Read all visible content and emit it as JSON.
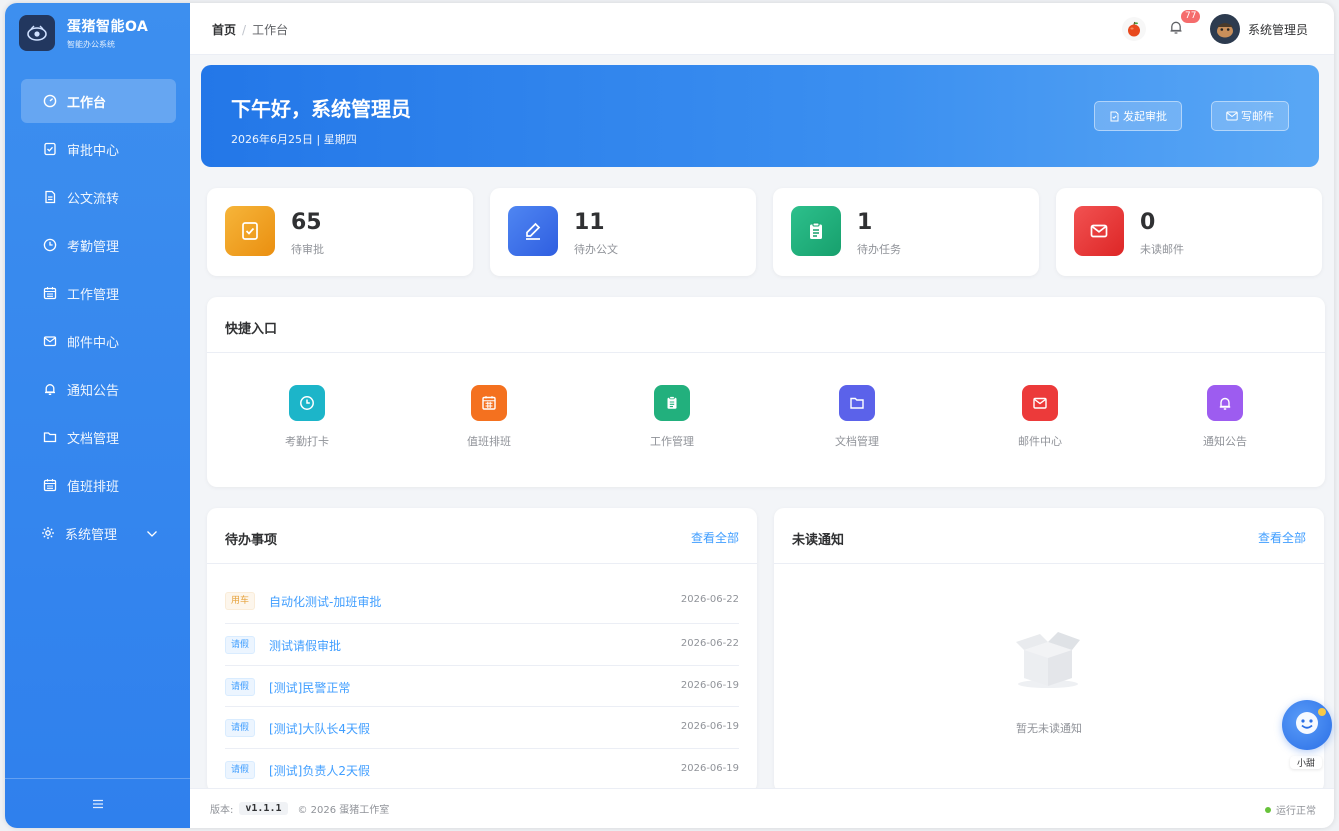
{
  "brand": {
    "title": "蛋猪智能OA",
    "subtitle": "智能办公系统"
  },
  "sidebar": {
    "items": [
      {
        "label": "工作台",
        "icon": "dashboard-icon",
        "active": true
      },
      {
        "label": "审批中心",
        "icon": "approval-icon"
      },
      {
        "label": "公文流转",
        "icon": "document-icon"
      },
      {
        "label": "考勤管理",
        "icon": "clock-icon"
      },
      {
        "label": "工作管理",
        "icon": "calendar-icon"
      },
      {
        "label": "邮件中心",
        "icon": "mail-icon"
      },
      {
        "label": "通知公告",
        "icon": "bell-icon"
      },
      {
        "label": "文档管理",
        "icon": "folder-icon"
      },
      {
        "label": "值班排班",
        "icon": "schedule-icon"
      },
      {
        "label": "系统管理",
        "icon": "gear-icon",
        "expandable": true
      }
    ],
    "footer_icon": "hamburger-icon"
  },
  "header": {
    "breadcrumb": {
      "home": "首页",
      "separator": "/",
      "current": "工作台"
    },
    "notification_count": "77",
    "user_name": "系统管理员"
  },
  "banner": {
    "greeting": "下午好，系统管理员",
    "date": "2026年6月25日 | 星期四",
    "btn_approval": "发起审批",
    "btn_mail": "写邮件"
  },
  "stats": [
    {
      "value": "65",
      "label": "待审批",
      "color": "#f0a020"
    },
    {
      "value": "11",
      "label": "待办公文",
      "color": "#3f6fe6"
    },
    {
      "value": "1",
      "label": "待办任务",
      "color": "#22b07d"
    },
    {
      "value": "0",
      "label": "未读邮件",
      "color": "#ec3a3a"
    }
  ],
  "quick": {
    "title": "快捷入口",
    "items": [
      {
        "label": "考勤打卡",
        "color": "#1cb5c9"
      },
      {
        "label": "值班排班",
        "color": "#f4711f"
      },
      {
        "label": "工作管理",
        "color": "#22b07d"
      },
      {
        "label": "文档管理",
        "color": "#5b62ea"
      },
      {
        "label": "邮件中心",
        "color": "#ec3a3a"
      },
      {
        "label": "通知公告",
        "color": "#9d5cf0"
      }
    ]
  },
  "todo": {
    "title": "待办事项",
    "view_all": "查看全部",
    "rows": [
      {
        "tag": "用车",
        "tag_type": "car",
        "title": "自动化测试-加班审批",
        "date": "2026-06-22"
      },
      {
        "tag": "请假",
        "tag_type": "leave",
        "title": "测试请假审批",
        "date": "2026-06-22"
      },
      {
        "tag": "请假",
        "tag_type": "leave",
        "title": "[测试]民警正常",
        "date": "2026-06-19"
      },
      {
        "tag": "请假",
        "tag_type": "leave",
        "title": "[测试]大队长4天假",
        "date": "2026-06-19"
      },
      {
        "tag": "请假",
        "tag_type": "leave",
        "title": "[测试]负责人2天假",
        "date": "2026-06-19"
      }
    ]
  },
  "notice": {
    "title": "未读通知",
    "view_all": "查看全部",
    "empty_text": "暂无未读通知"
  },
  "footer": {
    "version_label": "版本:",
    "version": "v1.1.1",
    "copyright": "© 2026 蛋猪工作室",
    "status": "运行正常"
  },
  "assistant": {
    "label": "小甜"
  }
}
